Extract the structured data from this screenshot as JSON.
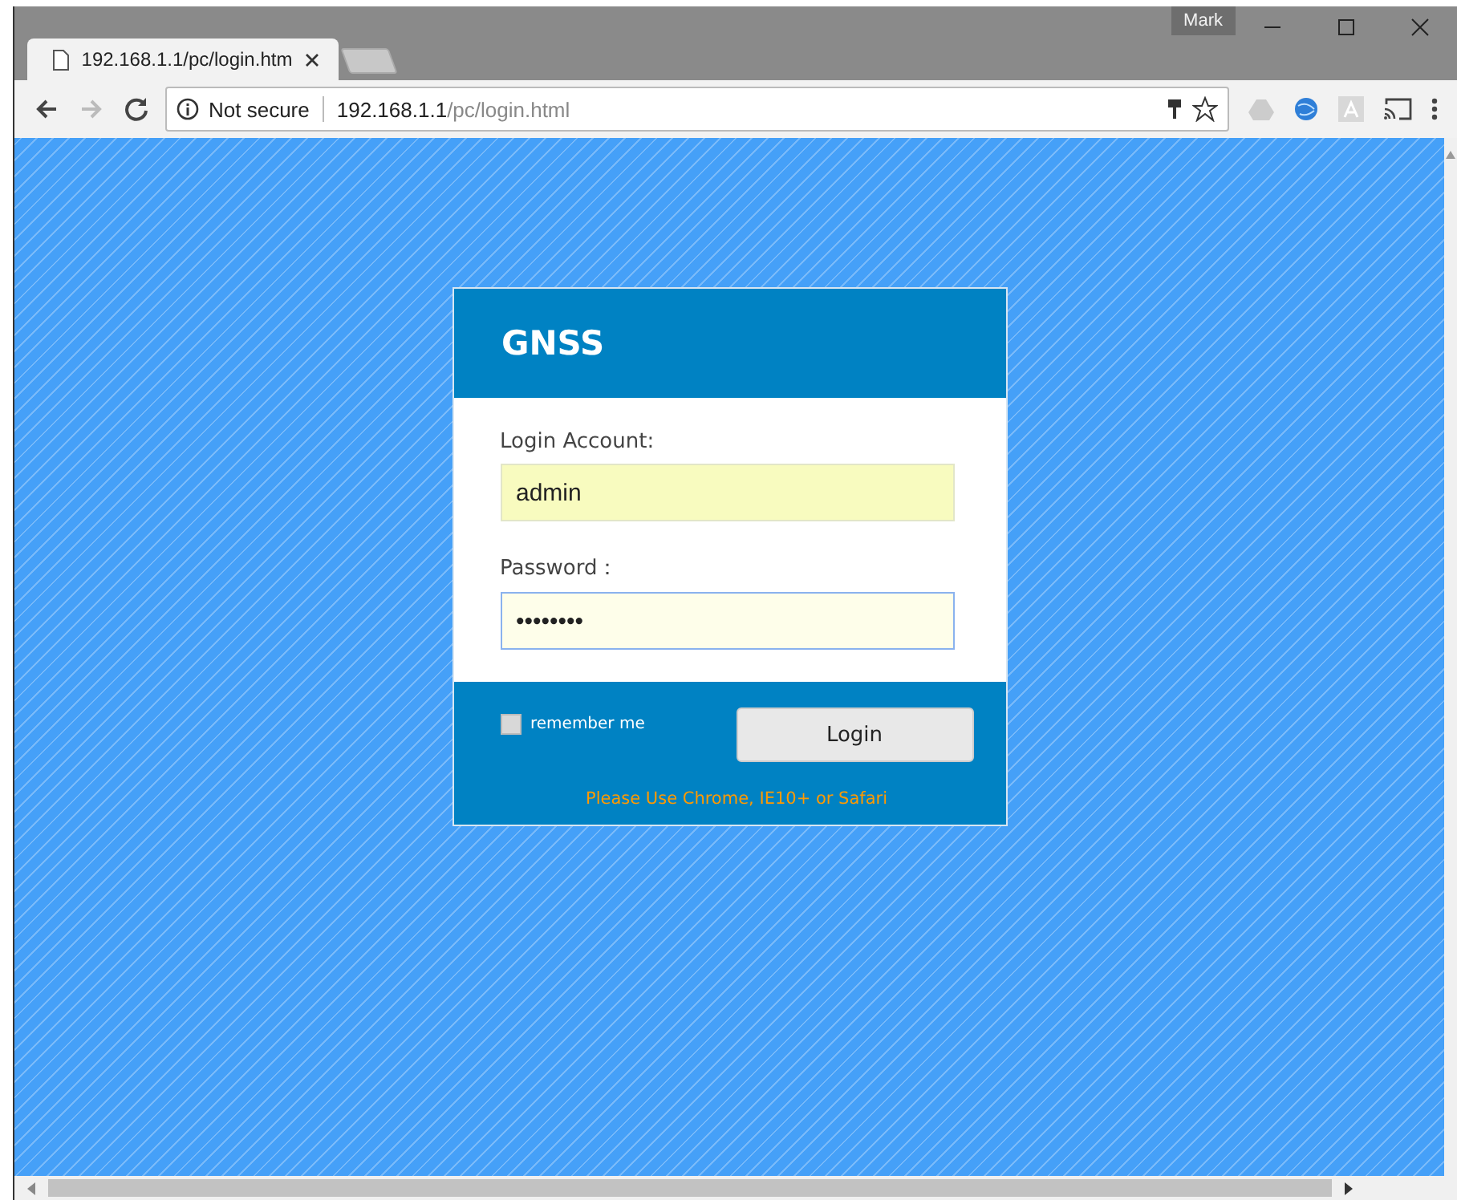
{
  "browser": {
    "tabs": [
      {
        "title": "192.168.1.1/pc/login.htm",
        "selected": true
      }
    ],
    "profile": "Mark",
    "address": {
      "security": "Not secure",
      "host": "192.168.1.1",
      "path": "/pc/login.html"
    }
  },
  "login": {
    "title": "GNSS",
    "fields": [
      {
        "label": "Login Account:",
        "value": "admin",
        "focused": false
      },
      {
        "label": "Password：",
        "value": "••••••••",
        "focused": true
      }
    ],
    "remember": {
      "label": "remember me",
      "checked": false
    },
    "button": "Login",
    "notice": "Please Use Chrome, IE10+ or Safari"
  }
}
